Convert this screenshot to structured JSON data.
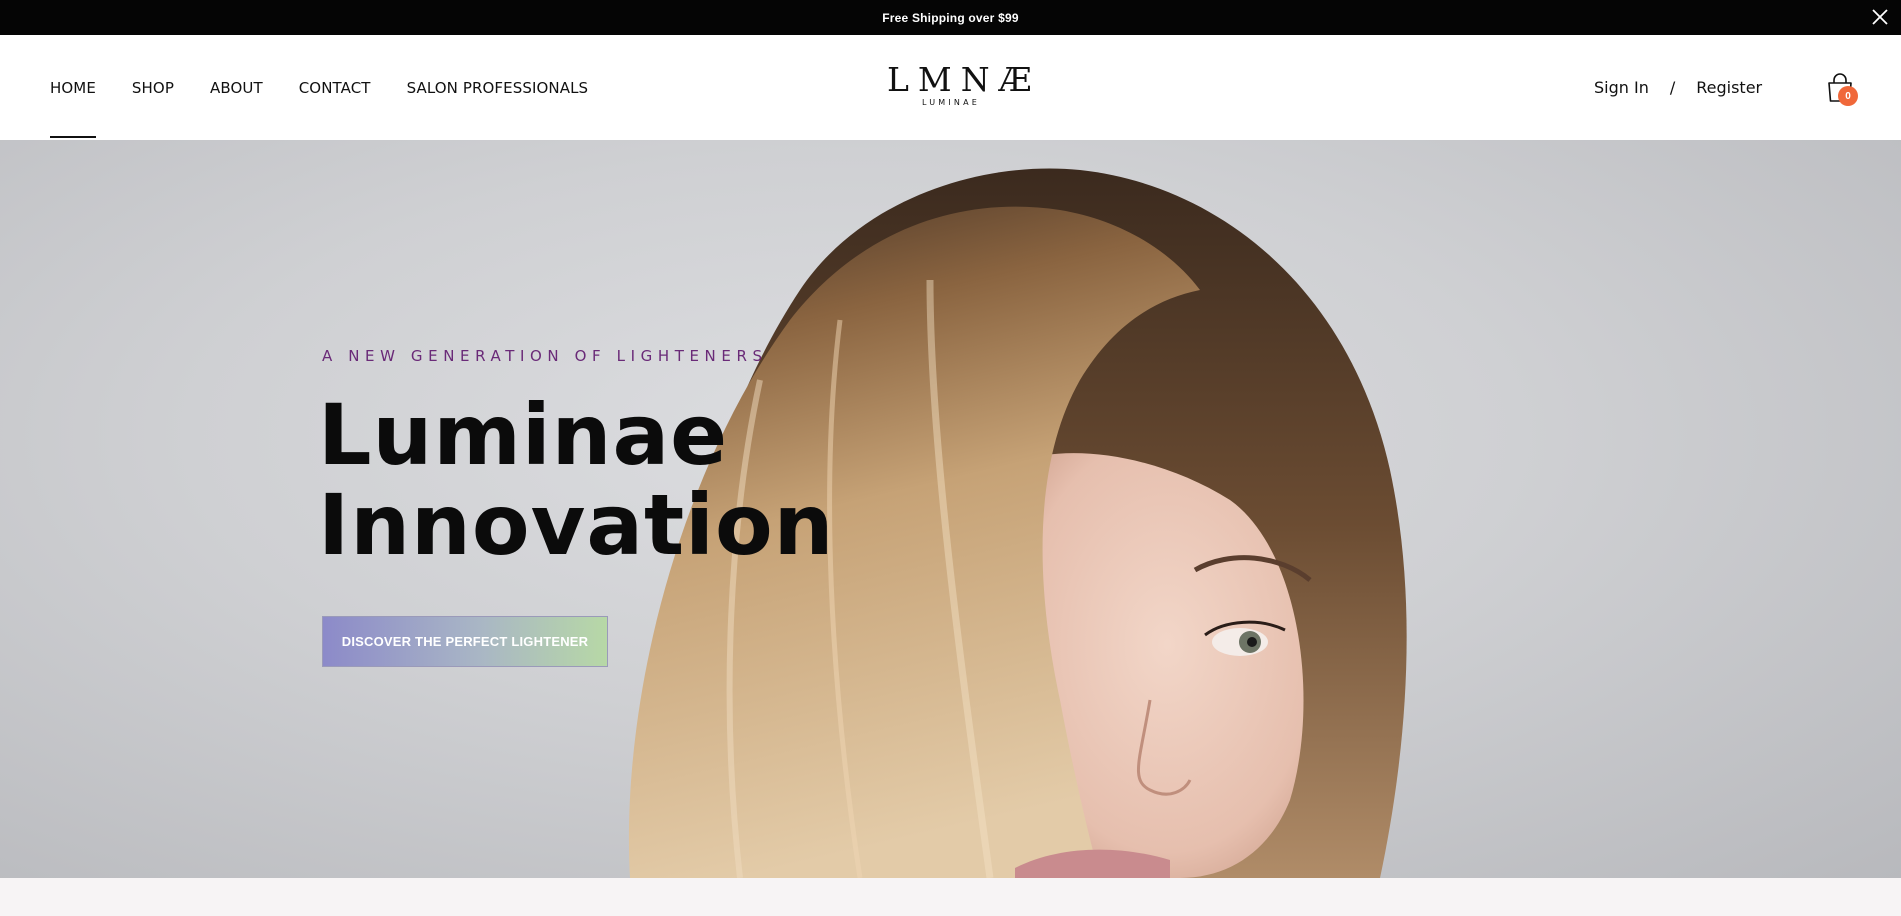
{
  "announcement": {
    "text": "Free Shipping over $99"
  },
  "nav": {
    "items": [
      {
        "label": "HOME",
        "active": true
      },
      {
        "label": "SHOP",
        "active": false
      },
      {
        "label": "ABOUT",
        "active": false
      },
      {
        "label": "CONTACT",
        "active": false
      },
      {
        "label": "SALON PROFESSIONALS",
        "active": false
      }
    ]
  },
  "logo": {
    "main": "LMNÆ",
    "sub": "LUMINAE"
  },
  "account": {
    "sign_in": "Sign In",
    "separator": "/",
    "register": "Register"
  },
  "cart": {
    "count": "0",
    "icon": "shopping-bag-icon"
  },
  "hero": {
    "eyebrow": "A NEW GENERATION OF LIGHTENERS",
    "title_line1": "Luminae",
    "title_line2": "Innovation",
    "cta": "DISCOVER THE PERFECT LIGHTENER"
  },
  "colors": {
    "announcement_bg": "#050505",
    "eyebrow": "#6a2a78",
    "cart_badge": "#f0683a",
    "cta_gradient_start": "#8c8ac9",
    "cta_gradient_end": "#b7d8a6"
  }
}
